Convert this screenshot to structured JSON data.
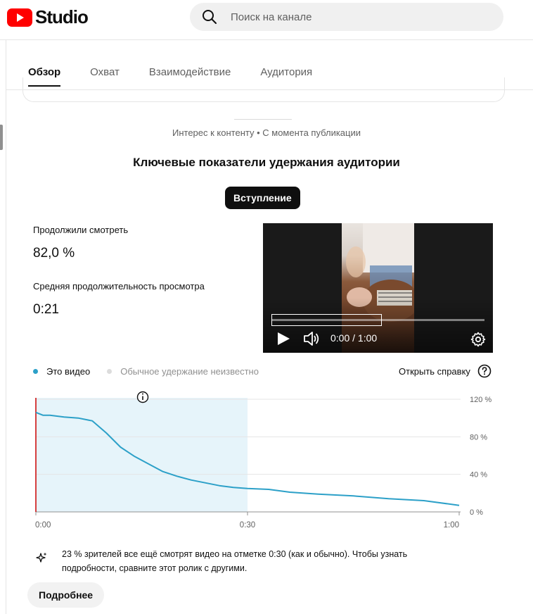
{
  "header": {
    "logo_text": "Studio",
    "search_placeholder": "Поиск на канале"
  },
  "tabs": [
    {
      "label": "Обзор",
      "active": true
    },
    {
      "label": "Охват",
      "active": false
    },
    {
      "label": "Взаимодействие",
      "active": false
    },
    {
      "label": "Аудитория",
      "active": false
    }
  ],
  "section": {
    "subtitle": "Интерес к контенту • С момента публикации",
    "title": "Ключевые показатели удержания аудитории",
    "chip_label": "Вступление"
  },
  "metrics": {
    "continued_label": "Продолжили смотреть",
    "continued_value": "82,0 %",
    "avg_duration_label": "Средняя продолжительность просмотра",
    "avg_duration_value": "0:21"
  },
  "video": {
    "time": "0:00 / 1:00"
  },
  "legend": {
    "this_video": "Это видео",
    "typical": "Обычное удержание неизвестно",
    "help_label": "Открыть справку",
    "this_video_color": "#2ca0c8",
    "typical_color": "#dcdcdc"
  },
  "chart_data": {
    "type": "line",
    "series": [
      {
        "name": "Это видео",
        "x": [
          0,
          1,
          2,
          4,
          6,
          8,
          10,
          12,
          14,
          16,
          18,
          20,
          22,
          24,
          26,
          28,
          30,
          33,
          36,
          40,
          45,
          50,
          55,
          60
        ],
        "values": [
          106,
          103,
          103,
          101,
          100,
          97,
          84,
          69,
          59,
          51,
          43,
          38,
          34,
          31,
          28,
          26,
          25,
          24,
          21,
          19,
          17,
          14,
          12,
          7
        ]
      }
    ],
    "x_ticks": [
      "0:00",
      "0:30",
      "1:00"
    ],
    "y_ticks": [
      "120 %",
      "80 %",
      "40 %",
      "0 %"
    ],
    "xlim": [
      0,
      60
    ],
    "ylim": [
      0,
      120
    ],
    "highlight_range": [
      0,
      30
    ],
    "marker_x": 0,
    "grid": true
  },
  "insight": {
    "text": "23 % зрителей все ещё смотрят видео на отметке 0:30 (как и обычно). Чтобы узнать подробности, сравните этот ролик с другими."
  },
  "more_button": "Подробнее"
}
